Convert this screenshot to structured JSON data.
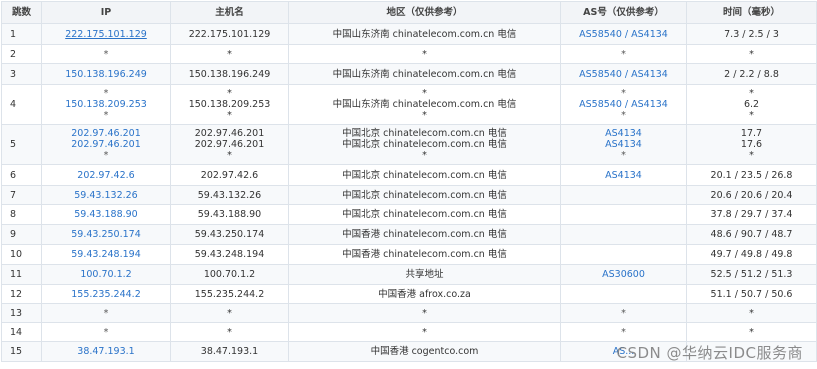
{
  "headers": [
    "跳数",
    "IP",
    "主机名",
    "地区（仅供参考）",
    "AS号（仅供参考）",
    "时间（毫秒）"
  ],
  "rows": [
    {
      "hop": "1",
      "ip": [
        "222.175.101.129"
      ],
      "host": [
        "222.175.101.129"
      ],
      "region": [
        "中国山东济南 chinatelecom.com.cn 电信"
      ],
      "as": [
        [
          "AS58540",
          "AS4134"
        ]
      ],
      "time": [
        "7.3 / 2.5 / 3"
      ]
    },
    {
      "hop": "2",
      "ip": [
        "*"
      ],
      "host": [
        "*"
      ],
      "region": [
        "*"
      ],
      "as": [
        [
          "*"
        ]
      ],
      "time": [
        "*"
      ]
    },
    {
      "hop": "3",
      "ip": [
        "150.138.196.249"
      ],
      "host": [
        "150.138.196.249"
      ],
      "region": [
        "中国山东济南 chinatelecom.com.cn 电信"
      ],
      "as": [
        [
          "AS58540",
          "AS4134"
        ]
      ],
      "time": [
        "2 / 2.2 / 8.8"
      ]
    },
    {
      "hop": "4",
      "ip": [
        "*",
        "150.138.209.253",
        "*"
      ],
      "host": [
        "*",
        "150.138.209.253",
        "*"
      ],
      "region": [
        "*",
        "中国山东济南 chinatelecom.com.cn 电信",
        "*"
      ],
      "as": [
        [
          "*"
        ],
        [
          "AS58540",
          "AS4134"
        ],
        [
          "*"
        ]
      ],
      "time": [
        "*",
        "6.2",
        "*"
      ]
    },
    {
      "hop": "5",
      "ip": [
        "202.97.46.201",
        "202.97.46.201",
        "*"
      ],
      "host": [
        "202.97.46.201",
        "202.97.46.201",
        "*"
      ],
      "region": [
        "中国北京 chinatelecom.com.cn 电信",
        "中国北京 chinatelecom.com.cn 电信",
        "*"
      ],
      "as": [
        [
          "AS4134"
        ],
        [
          "AS4134"
        ],
        [
          "*"
        ]
      ],
      "time": [
        "17.7",
        "17.6",
        "*"
      ]
    },
    {
      "hop": "6",
      "ip": [
        "202.97.42.6"
      ],
      "host": [
        "202.97.42.6"
      ],
      "region": [
        "中国北京 chinatelecom.com.cn 电信"
      ],
      "as": [
        [
          "AS4134"
        ]
      ],
      "time": [
        "20.1 / 23.5 / 26.8"
      ]
    },
    {
      "hop": "7",
      "ip": [
        "59.43.132.26"
      ],
      "host": [
        "59.43.132.26"
      ],
      "region": [
        "中国北京 chinatelecom.com.cn 电信"
      ],
      "as": [
        []
      ],
      "time": [
        "20.6 / 20.6 / 20.4"
      ]
    },
    {
      "hop": "8",
      "ip": [
        "59.43.188.90"
      ],
      "host": [
        "59.43.188.90"
      ],
      "region": [
        "中国北京 chinatelecom.com.cn 电信"
      ],
      "as": [
        []
      ],
      "time": [
        "37.8 / 29.7 / 37.4"
      ]
    },
    {
      "hop": "9",
      "ip": [
        "59.43.250.174"
      ],
      "host": [
        "59.43.250.174"
      ],
      "region": [
        "中国香港 chinatelecom.com.cn 电信"
      ],
      "as": [
        []
      ],
      "time": [
        "48.6 / 90.7 / 48.7"
      ]
    },
    {
      "hop": "10",
      "ip": [
        "59.43.248.194"
      ],
      "host": [
        "59.43.248.194"
      ],
      "region": [
        "中国香港 chinatelecom.com.cn 电信"
      ],
      "as": [
        []
      ],
      "time": [
        "49.7 / 49.8 / 49.8"
      ]
    },
    {
      "hop": "11",
      "ip": [
        "100.70.1.2"
      ],
      "host": [
        "100.70.1.2"
      ],
      "region": [
        "共享地址"
      ],
      "as": [
        [
          "AS30600"
        ]
      ],
      "time": [
        "52.5 / 51.2 / 51.3"
      ]
    },
    {
      "hop": "12",
      "ip": [
        "155.235.244.2"
      ],
      "host": [
        "155.235.244.2"
      ],
      "region": [
        "中国香港 afrox.co.za"
      ],
      "as": [
        []
      ],
      "time": [
        "51.1 / 50.7 / 50.6"
      ]
    },
    {
      "hop": "13",
      "ip": [
        "*"
      ],
      "host": [
        "*"
      ],
      "region": [
        "*"
      ],
      "as": [
        [
          "*"
        ]
      ],
      "time": [
        "*"
      ]
    },
    {
      "hop": "14",
      "ip": [
        "*"
      ],
      "host": [
        "*"
      ],
      "region": [
        "*"
      ],
      "as": [
        [
          "*"
        ]
      ],
      "time": [
        "*"
      ]
    },
    {
      "hop": "15",
      "ip": [
        "38.47.193.1"
      ],
      "host": [
        "38.47.193.1"
      ],
      "region": [
        "中国香港 cogentco.com"
      ],
      "as": [
        [
          "AS..."
        ]
      ],
      "time": [
        ""
      ]
    }
  ],
  "as_separator": " / ",
  "watermark": "CSDN @华纳云IDC服务商",
  "colors": {
    "link": "#2a73c9",
    "border": "#dde3ea",
    "header_bg": "#f2f4f7"
  }
}
